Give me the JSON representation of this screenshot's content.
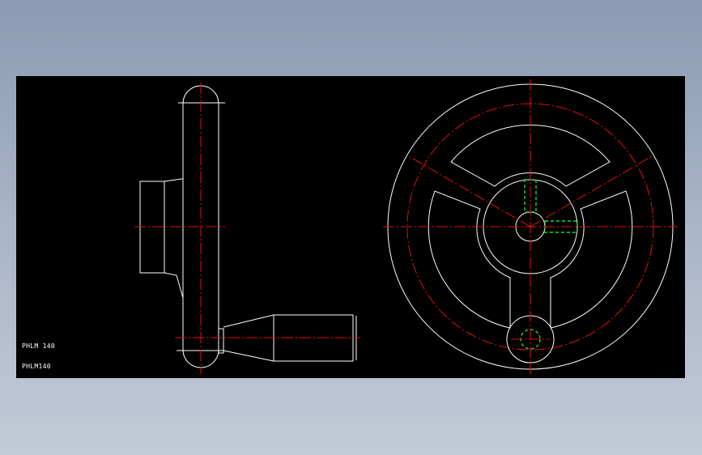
{
  "drawing": {
    "labels": {
      "model_name_1": "PHLM 140",
      "model_name_2": "PHLM140"
    },
    "colors": {
      "background": "#000000",
      "outline": "#ffffff",
      "centerline": "#e01010",
      "hidden_feature": "#1fdc1f"
    }
  }
}
